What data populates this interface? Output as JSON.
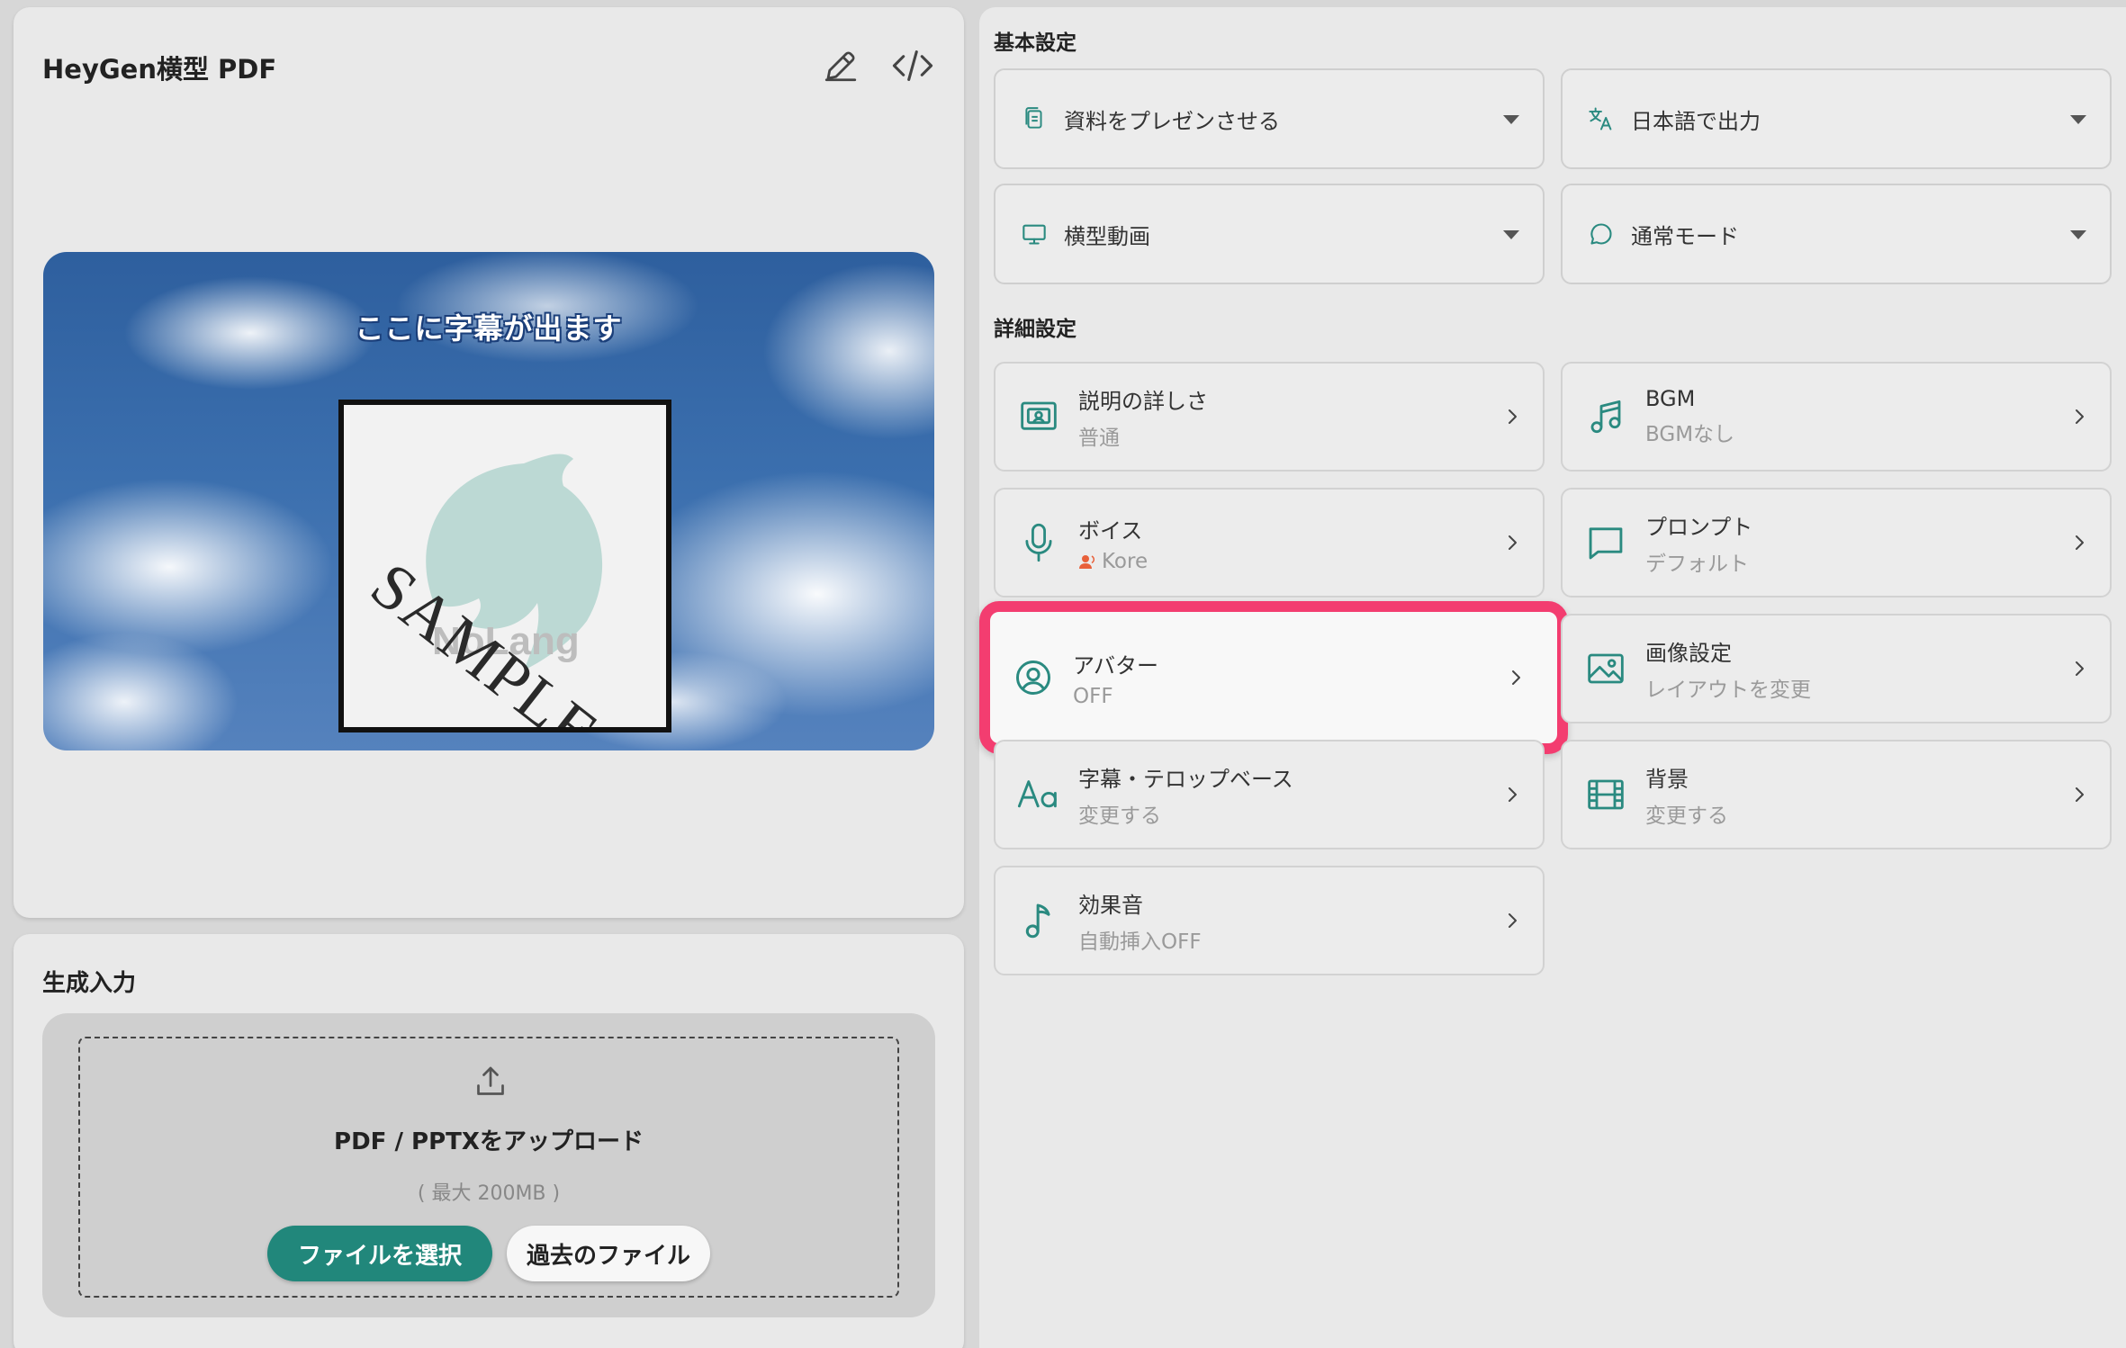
{
  "preview": {
    "title": "HeyGen横型 PDF",
    "subtitle_overlay": "ここに字幕が出ます",
    "sample_stamp": "SAMPLE",
    "logo_text": "NoLang"
  },
  "input": {
    "title": "生成入力",
    "upload_title": "PDF / PPTXをアップロード",
    "upload_limit": "( 最大 200MB )",
    "select_file_label": "ファイルを選択",
    "past_files_label": "過去のファイル"
  },
  "basic_settings": {
    "title": "基本設定",
    "selects": [
      {
        "icon": "document-icon",
        "label": "資料をプレゼンさせる"
      },
      {
        "icon": "translate-icon",
        "label": "日本語で出力"
      },
      {
        "icon": "monitor-icon",
        "label": "横型動画"
      },
      {
        "icon": "chat-bubble-icon",
        "label": "通常モード"
      }
    ]
  },
  "detail_settings": {
    "title": "詳細設定",
    "cards": [
      {
        "icon": "presentation-icon",
        "title": "説明の詳しさ",
        "sub": "普通"
      },
      {
        "icon": "music-notes-icon",
        "title": "BGM",
        "sub": "BGMなし"
      },
      {
        "icon": "microphone-icon",
        "title": "ボイス",
        "sub": "Kore"
      },
      {
        "icon": "speech-box-icon",
        "title": "プロンプト",
        "sub": "デフォルト"
      },
      {
        "icon": "user-circle-icon",
        "title": "アバター",
        "sub": "OFF"
      },
      {
        "icon": "image-icon",
        "title": "画像設定",
        "sub": "レイアウトを変更"
      },
      {
        "icon": "text-aa-icon",
        "title": "字幕・テロップベース",
        "sub": "変更する"
      },
      {
        "icon": "film-icon",
        "title": "背景",
        "sub": "変更する"
      },
      {
        "icon": "music-note-icon",
        "title": "効果音",
        "sub": "自動挿入OFF"
      }
    ]
  },
  "colors": {
    "accent": "#21877b",
    "highlight": "#f33d70",
    "icon": "#2a8a80"
  }
}
